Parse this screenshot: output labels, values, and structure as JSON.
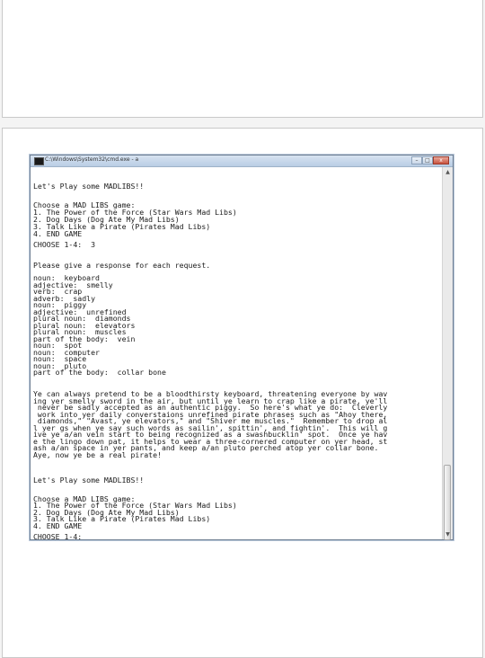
{
  "window": {
    "title": "C:\\Windows\\System32\\cmd.exe - a",
    "controls": [
      "–",
      "□",
      "x"
    ]
  },
  "console_lines": [
    "Let's Play some MADLIBS!!",
    "",
    "Choose a MAD LIBS game:",
    "1. The Power of the Force (Star Wars Mad Libs)",
    "2. Dog Days (Dog Ate My Mad Libs)",
    "3. Talk Like a Pirate (Pirates Mad Libs)",
    "4. END GAME",
    "CHOOSE 1-4:  3",
    "",
    "Please give a response for each request.",
    "",
    "noun:  keyboard",
    "adjective:  smelly",
    "verb:  crap",
    "adverb:  sadly",
    "noun:  piggy",
    "adjective:  unrefined",
    "plural noun:  diamonds",
    "plural noun:  elevators",
    "plural noun:  muscles",
    "part of the body:  vein",
    "noun:  spot",
    "noun:  computer",
    "noun:  space",
    "noun:  pluto",
    "part of the body:  collar bone",
    "",
    "Ye can always pretend to be a bloodthirsty keyboard, threatening everyone by wav",
    "ing yer smelly sword in the air, but until ye learn to crap like a pirate, ye'll",
    " never be sadly accepted as an authentic piggy.  So here's what ye do:  Cleverly",
    " work into yer daily converstaions unrefined pirate phrases such as \"Ahoy there,",
    " diamonds,\" \"Avast, ye elevators,\" and \"Shiver me muscles.\"  Remember to drop al",
    "l yer gs when ye say such words as sailin', spittin', and fightin'.  This will g",
    "ive ye a/an vein start to being recognized as a swashbucklin' spot.  Once ye hav",
    "e the lingo down pat, it helps to wear a three-cornered computer on yer head, st",
    "ash a/an space in yer pants, and keep a/an pluto perched atop yer collar bone.",
    "Aye, now ye be a real pirate!",
    "",
    "",
    "Let's Play some MADLIBS!!",
    "",
    "Choose a MAD LIBS game:",
    "1. The Power of the Force (Star Wars Mad Libs)",
    "2. Dog Days (Dog Ate My Mad Libs)",
    "3. Talk Like a Pirate (Pirates Mad Libs)",
    "4. END GAME",
    "CHOOSE 1-4:"
  ],
  "scrollbar": {
    "up_arrow": "▲",
    "down_arrow": "▼"
  }
}
